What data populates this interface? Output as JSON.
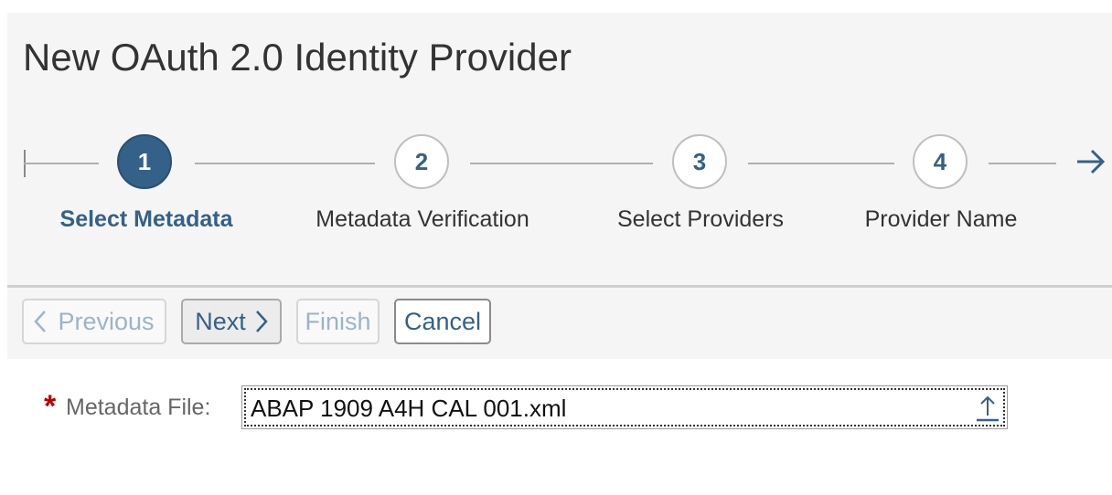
{
  "page": {
    "title": "New OAuth 2.0 Identity Provider"
  },
  "roadmap": {
    "steps": [
      {
        "number": "1",
        "label": "Select Metadata",
        "active": true
      },
      {
        "number": "2",
        "label": "Metadata Verification",
        "active": false
      },
      {
        "number": "3",
        "label": "Select Providers",
        "active": false
      },
      {
        "number": "4",
        "label": "Provider Name",
        "active": false
      }
    ],
    "more_icon": "arrow-right-icon"
  },
  "toolbar": {
    "previous_label": "Previous",
    "next_label": "Next",
    "finish_label": "Finish",
    "cancel_label": "Cancel",
    "previous_icon": "chevron-left-icon",
    "next_icon": "chevron-right-icon"
  },
  "form": {
    "required_marker": "*",
    "metadata_file_label": "Metadata File:",
    "metadata_file_value": "ABAP 1909 A4H CAL 001.xml",
    "upload_icon": "upload-icon"
  },
  "colors": {
    "accent": "#346187",
    "required": "#bb0000",
    "panel_bg": "#f5f5f5"
  }
}
